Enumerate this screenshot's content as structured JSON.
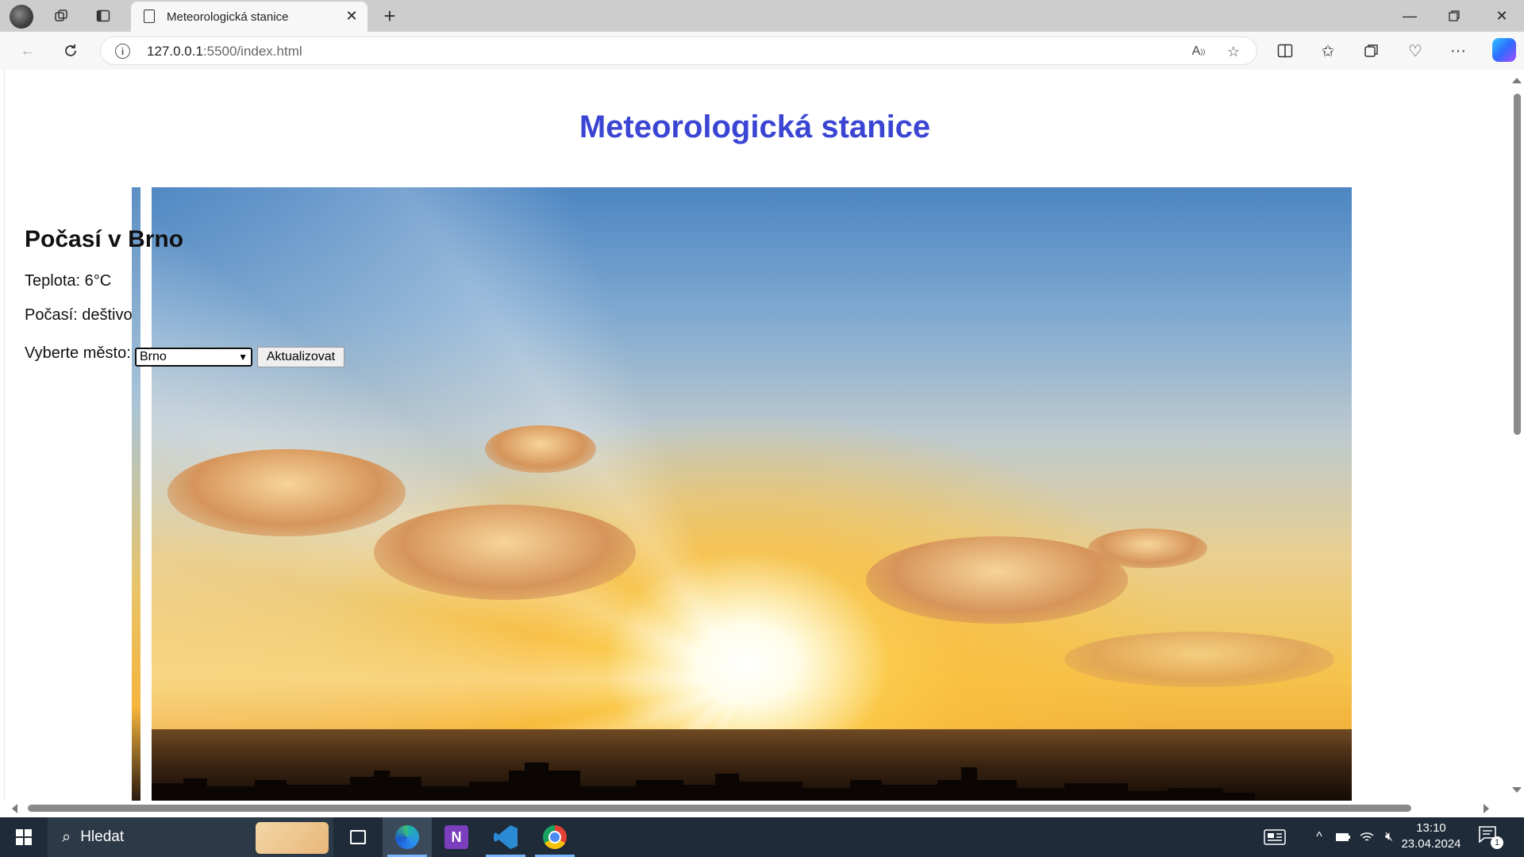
{
  "browser": {
    "tab_title": "Meteorologická stanice",
    "url_host": "127.0.0.1",
    "url_rest": ":5500/index.html",
    "read_aloud_label": "A҆"
  },
  "page": {
    "heading": "Meteorologická stanice",
    "weather_heading": "Počasí v Brno",
    "temperature": "Teplota: 6°C",
    "condition": "Počasí: deštivo",
    "city_label": "Vyberte město:",
    "city_selected": "Brno",
    "update_button": "Aktualizovat"
  },
  "taskbar": {
    "search_text": "Hledat",
    "onenote_letter": "N",
    "time": "13:10",
    "date": "23.04.2024",
    "notification_count": "1"
  },
  "colors": {
    "heading": "#3b45d4",
    "taskbar": "#1f2b38"
  }
}
